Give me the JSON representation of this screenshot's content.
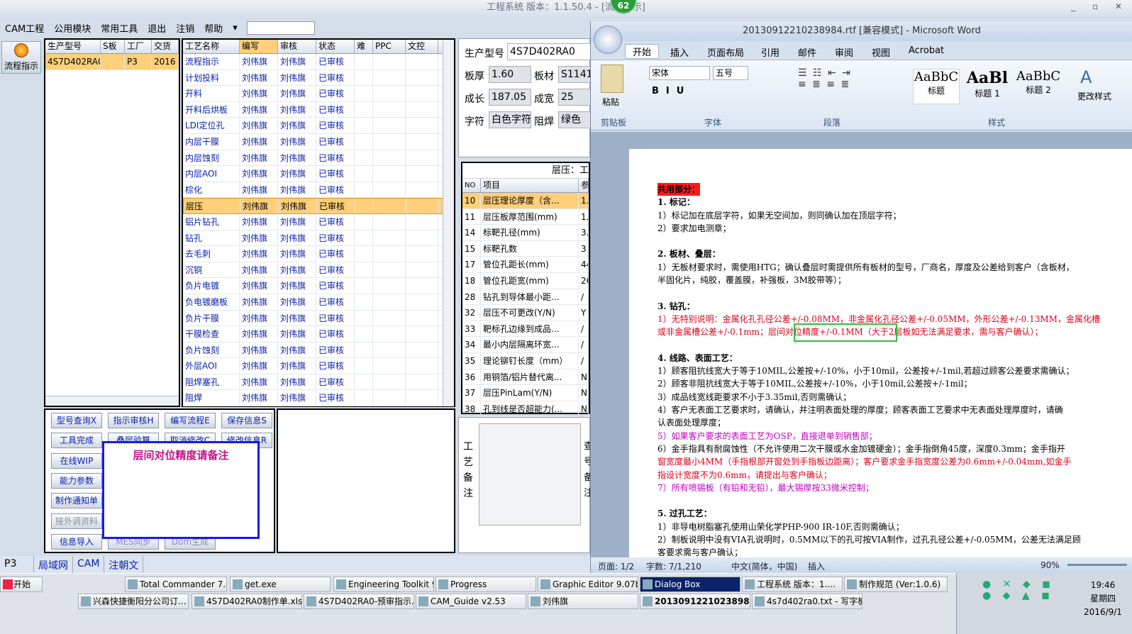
{
  "app": {
    "title": "工程系统   版本：1.1.50.4 - [流程指示]",
    "badge": "62"
  },
  "menu": [
    "CAM工程",
    "公用模块",
    "常用工具",
    "退出",
    "注销",
    "帮助"
  ],
  "side_button": "流程指示",
  "job_list": {
    "headers": [
      "生产型号",
      "S板",
      "工厂",
      "交货"
    ],
    "rows": [
      [
        "4S7D402RA0",
        "",
        "P3",
        "2016"
      ]
    ]
  },
  "process_grid": {
    "headers": [
      "工艺名称",
      "编写",
      "审核",
      "状态",
      "难",
      "PPC",
      "文控"
    ],
    "rows": [
      [
        "流程指示",
        "刘伟旗",
        "刘伟旗",
        "已审核"
      ],
      [
        "计划投料",
        "刘伟旗",
        "刘伟旗",
        "已审核"
      ],
      [
        "开料",
        "刘伟旗",
        "刘伟旗",
        "已审核"
      ],
      [
        "开料后烘板",
        "刘伟旗",
        "刘伟旗",
        "已审核"
      ],
      [
        "LDI定位孔",
        "刘伟旗",
        "刘伟旗",
        "已审核"
      ],
      [
        "内层干膜",
        "刘伟旗",
        "刘伟旗",
        "已审核"
      ],
      [
        "内层蚀刻",
        "刘伟旗",
        "刘伟旗",
        "已审核"
      ],
      [
        "内层AOI",
        "刘伟旗",
        "刘伟旗",
        "已审核"
      ],
      [
        "棕化",
        "刘伟旗",
        "刘伟旗",
        "已审核"
      ],
      [
        "层压",
        "刘伟旗",
        "刘伟旗",
        "已审核"
      ],
      [
        "铝片钻孔",
        "刘伟旗",
        "刘伟旗",
        "已审核"
      ],
      [
        "钻孔",
        "刘伟旗",
        "刘伟旗",
        "已审核"
      ],
      [
        "去毛刺",
        "刘伟旗",
        "刘伟旗",
        "已审核"
      ],
      [
        "沉铜",
        "刘伟旗",
        "刘伟旗",
        "已审核"
      ],
      [
        "负片电镀",
        "刘伟旗",
        "刘伟旗",
        "已审核"
      ],
      [
        "负电镀磨板",
        "刘伟旗",
        "刘伟旗",
        "已审核"
      ],
      [
        "负片干膜",
        "刘伟旗",
        "刘伟旗",
        "已审核"
      ],
      [
        "干膜检查",
        "刘伟旗",
        "刘伟旗",
        "已审核"
      ],
      [
        "负片蚀刻",
        "刘伟旗",
        "刘伟旗",
        "已审核"
      ],
      [
        "外层AOI",
        "刘伟旗",
        "刘伟旗",
        "已审核"
      ],
      [
        "阻焊塞孔",
        "刘伟旗",
        "刘伟旗",
        "已审核"
      ],
      [
        "阻焊",
        "刘伟旗",
        "刘伟旗",
        "已审核"
      ]
    ]
  },
  "buttons": [
    [
      "型号查询X",
      "指示审核H",
      "编写流程E",
      "保存信息S"
    ],
    [
      "工具完成",
      "叠层验算",
      "取消修改C",
      "修改信息R"
    ],
    [
      "在线WIP",
      "",
      "",
      ""
    ],
    [
      "能力参数",
      "",
      "",
      ""
    ],
    [
      "制作通知单",
      "",
      "",
      ""
    ],
    [
      "接外调资料",
      "",
      "",
      ""
    ],
    [
      "信息导入",
      "MES同步",
      "Dom生成",
      ""
    ]
  ],
  "dialog_text": "层间对位精度请备注",
  "info": {
    "prod_label": "生产型号",
    "prod_value": "4S7D402RA0",
    "thick_label": "板厚",
    "thick_value": "1.60",
    "mat_label": "板材",
    "mat_value": "S1141",
    "len_label": "成长",
    "len_value": "187.05",
    "wid_label": "成宽",
    "wid_value": "25",
    "char_label": "字符",
    "char_value": "白色字符",
    "mask_label": "阻焊",
    "mask_value": "绿色"
  },
  "layer_table": {
    "caption": "层压：工",
    "headers": [
      "NO",
      "项目",
      "参"
    ],
    "rows": [
      [
        "10",
        "层压理论厚度（含...",
        "1."
      ],
      [
        "11",
        "层压板厚范围(mm)",
        "1."
      ],
      [
        "14",
        "标靶孔径(mm)",
        "3."
      ],
      [
        "15",
        "标靶孔数",
        "3"
      ],
      [
        "17",
        "管位孔距长(mm)",
        "44"
      ],
      [
        "18",
        "管位孔距宽(mm)",
        "26"
      ],
      [
        "28",
        "钻孔到导体最小距...",
        "/"
      ],
      [
        "32",
        "层压不可更改(Y/N)",
        "Y"
      ],
      [
        "33",
        "靶标孔边缘到成品...",
        "/"
      ],
      [
        "34",
        "最小内层隔离环宽...",
        "/"
      ],
      [
        "35",
        "理论铆钉长度（mm）",
        "/"
      ],
      [
        "36",
        "用铜箔/铝片替代离...",
        "N"
      ],
      [
        "37",
        "层压PinLam(Y/N)",
        "N"
      ],
      [
        "38",
        "孔到线是否超能力(...",
        "N"
      ]
    ]
  },
  "remark_label": "工艺备注",
  "remark_label2": "查号备注",
  "bottombar": [
    "P3",
    "局域网",
    "CAM",
    "注朝文"
  ],
  "word": {
    "title": "20130912210238984.rtf [兼容模式] - Microsoft Word",
    "tabs": [
      "开始",
      "插入",
      "页面布局",
      "引用",
      "邮件",
      "审阅",
      "视图",
      "Acrobat"
    ],
    "font": "宋体",
    "size": "五号",
    "groups": [
      "剪贴板",
      "字体",
      "段落",
      "样式"
    ],
    "styles": [
      [
        "AaBbC",
        "标题"
      ],
      [
        "AaBl",
        "标题 1"
      ],
      [
        "AaBbC",
        "标题 2"
      ]
    ],
    "paste": "粘贴",
    "change_styles": "更改样式",
    "status": {
      "page": "页面: 1/2",
      "words": "字数: 7/1,210",
      "lang": "中文(简体，中国)",
      "mode": "插入",
      "zoom": "90%"
    },
    "doc": [
      {
        "t": "共用部分：",
        "s": "hl"
      },
      {
        "t": "1.   标记：",
        "s": "b"
      },
      {
        "t": "     1）标记加在底层字符，如果无空间加，则同确认加在顶层字符；",
        "s": ""
      },
      {
        "t": "     2）要求加电测章；",
        "s": ""
      },
      {
        "t": "",
        "s": ""
      },
      {
        "t": "2.   板材、叠层：",
        "s": "b"
      },
      {
        "t": "     1）无板材要求时，需使用HTG；确认叠层时需提供所有板材的型号，厂商名，厚度及公差给到客户（含板材，",
        "s": ""
      },
      {
        "t": "        半固化片，纯胶，覆盖膜，补强板，3M胶带等）；",
        "s": ""
      },
      {
        "t": "",
        "s": ""
      },
      {
        "t": "3.   钻孔：",
        "s": "b"
      },
      {
        "t": "     1）无特别说明：金属化孔孔径公差+/-0.08MM，非金属化孔径公差+/-0.05MM，外形公差+/-0.13MM，金属化槽",
        "s": "red"
      },
      {
        "t": "        或非金属槽公差+/-0.1mm；层间对位精度+/-0.1MM（大于2层板如无法满足要求，需与客户确认）；",
        "s": "red"
      },
      {
        "t": "",
        "s": ""
      },
      {
        "t": "4.   线路、表面工艺：",
        "s": "b"
      },
      {
        "t": "     1）顾客阻抗线宽大于等于10MIL,公差按+/-10%，小于10mil，公差按+/-1mil,若超过顾客公差要求需确认；",
        "s": ""
      },
      {
        "t": "     2）顾客非阻抗线宽大于等于10MIL,公差按+/-10%，小于10mil,公差按+/-1mil；",
        "s": ""
      },
      {
        "t": "     3）成品线宽线距要求不小于3.35mil,否则需确认；",
        "s": ""
      },
      {
        "t": "     4）客户无表面工艺要求时，请确认，并注明表面处理的厚度；顾客表面工艺要求中无表面处理厚度时，请确",
        "s": ""
      },
      {
        "t": "        认表面处理厚度；",
        "s": ""
      },
      {
        "t": "     5）如果客户要求的表面工艺为OSP，直接退单到销售部；",
        "s": "mag"
      },
      {
        "t": "     6）金手指具有耐腐蚀性（不允许使用二次干膜或水金加镀硬金）；金手指倒角45度，深度0.3mm；金手指开",
        "s": ""
      },
      {
        "t": "        窗宽度最小4MM（手指根部开窗处到手指板边距离）；客户要求金手指宽度公差为0.6mm+/-0.04mm,如金手",
        "s": "red"
      },
      {
        "t": "        指设计宽度不为0.6mm，请提出与客户确认；",
        "s": "red"
      },
      {
        "t": "     7）所有喷锡板（有铅和无铅），最大锡厚按33微米控制；",
        "s": "mag"
      },
      {
        "t": "",
        "s": ""
      },
      {
        "t": "5.   过孔工艺：",
        "s": "b"
      },
      {
        "t": "     1）非导电树脂塞孔使用山荣化学PHP-900 IR-10F,否则需确认；",
        "s": ""
      },
      {
        "t": "     2）制板说明中没有VIA孔说明时，0.5MM以下的孔可按VIA制作，过孔孔径公差+/-0.05MM，公差无法满足顾",
        "s": ""
      },
      {
        "t": "        客要求需与客户确认；",
        "s": ""
      }
    ]
  },
  "taskbar": {
    "start": "开始",
    "row1": [
      "Total Commander 7.0 ...",
      "get.exe",
      "Engineering Toolkit 9....",
      "Progress",
      "Graphic Editor 9.07b2...",
      "Dialog Box",
      "工程系统  版本：1....",
      "制作规范 (Ver:1.0.6)"
    ],
    "row2": [
      "兴森快捷衡阳分公司订...",
      "4S7D402RA0制作单.xls ...",
      "4S7D402RA0-预审指示....",
      "CAM_Guide v2.53",
      "刘伟旗",
      "20130912210238984....",
      "4s7d402ra0.txt - 写字板"
    ],
    "time": "19:46",
    "weekday": "星期四",
    "date": "2016/9/1"
  }
}
